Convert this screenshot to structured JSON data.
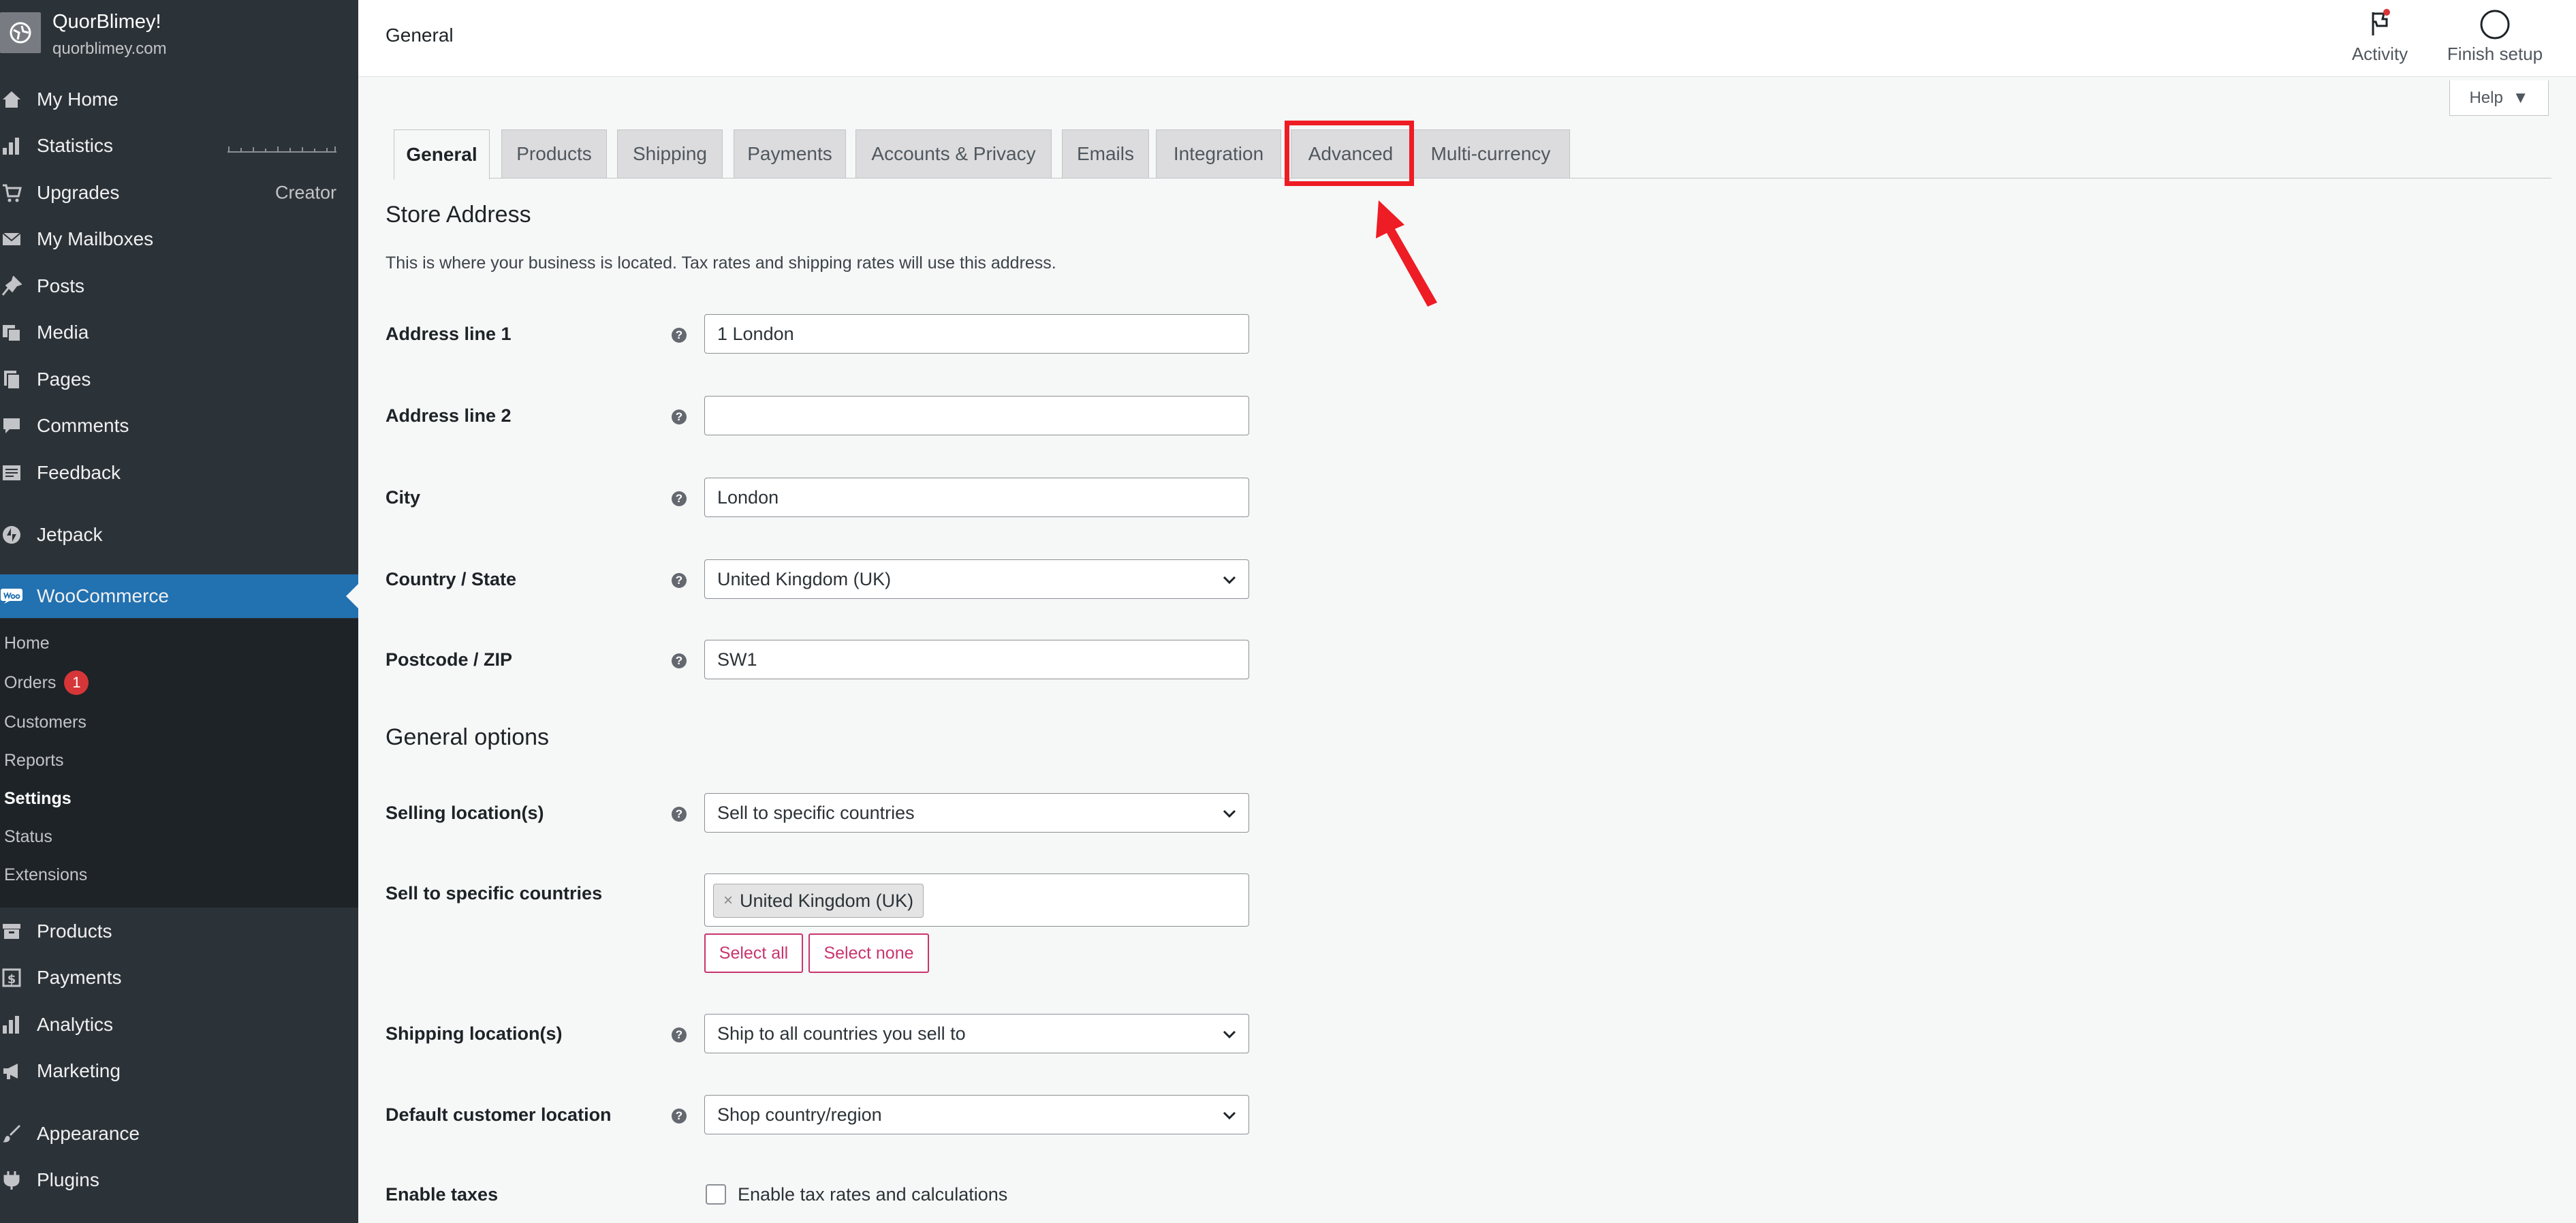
{
  "site": {
    "name": "QuorBlimey!",
    "url": "quorblimey.com"
  },
  "sidebar": {
    "items": [
      {
        "label": "My Home",
        "icon": "home-icon"
      },
      {
        "label": "Statistics",
        "icon": "bar-chart-icon"
      },
      {
        "label": "Upgrades",
        "icon": "cart-icon",
        "right": "Creator"
      },
      {
        "label": "My Mailboxes",
        "icon": "mail-icon"
      },
      {
        "label": "Posts",
        "icon": "pin-icon"
      },
      {
        "label": "Media",
        "icon": "media-icon"
      },
      {
        "label": "Pages",
        "icon": "pages-icon"
      },
      {
        "label": "Comments",
        "icon": "comment-icon"
      },
      {
        "label": "Feedback",
        "icon": "feedback-icon"
      },
      {
        "label": "Jetpack",
        "icon": "jetpack-icon"
      },
      {
        "label": "WooCommerce",
        "icon": "woo-icon"
      },
      {
        "label": "Products",
        "icon": "archive-icon"
      },
      {
        "label": "Payments",
        "icon": "dollar-icon"
      },
      {
        "label": "Analytics",
        "icon": "analytics-icon"
      },
      {
        "label": "Marketing",
        "icon": "megaphone-icon"
      },
      {
        "label": "Appearance",
        "icon": "brush-icon"
      },
      {
        "label": "Plugins",
        "icon": "plug-icon"
      }
    ],
    "woo_submenu": [
      {
        "label": "Home"
      },
      {
        "label": "Orders",
        "badge": "1"
      },
      {
        "label": "Customers"
      },
      {
        "label": "Reports"
      },
      {
        "label": "Settings"
      },
      {
        "label": "Status"
      },
      {
        "label": "Extensions"
      }
    ]
  },
  "topbar": {
    "title": "General",
    "activity_label": "Activity",
    "finish_setup_label": "Finish setup",
    "help_label": "Help"
  },
  "tabs": [
    "General",
    "Products",
    "Shipping",
    "Payments",
    "Accounts & Privacy",
    "Emails",
    "Integration",
    "Advanced",
    "Multi-currency"
  ],
  "active_tab": "General",
  "highlighted_tab": "Advanced",
  "colors": {
    "accent": "#2271b1",
    "highlight": "#ee1c24",
    "woo_button": "#c9356e"
  },
  "store_address": {
    "title": "Store Address",
    "description": "This is where your business is located. Tax rates and shipping rates will use this address.",
    "address1_label": "Address line 1",
    "address1_value": "1 London",
    "address2_label": "Address line 2",
    "address2_value": "",
    "city_label": "City",
    "city_value": "London",
    "country_label": "Country / State",
    "country_value": "United Kingdom (UK)",
    "postcode_label": "Postcode / ZIP",
    "postcode_value": "SW1"
  },
  "general_options": {
    "title": "General options",
    "selling_label": "Selling location(s)",
    "selling_value": "Sell to specific countries",
    "specific_label": "Sell to specific countries",
    "specific_chip": "United Kingdom (UK)",
    "select_all": "Select all",
    "select_none": "Select none",
    "shipping_label": "Shipping location(s)",
    "shipping_value": "Ship to all countries you sell to",
    "default_loc_label": "Default customer location",
    "default_loc_value": "Shop country/region",
    "taxes_label": "Enable taxes",
    "taxes_checkbox_label": "Enable tax rates and calculations",
    "taxes_checked": false
  }
}
